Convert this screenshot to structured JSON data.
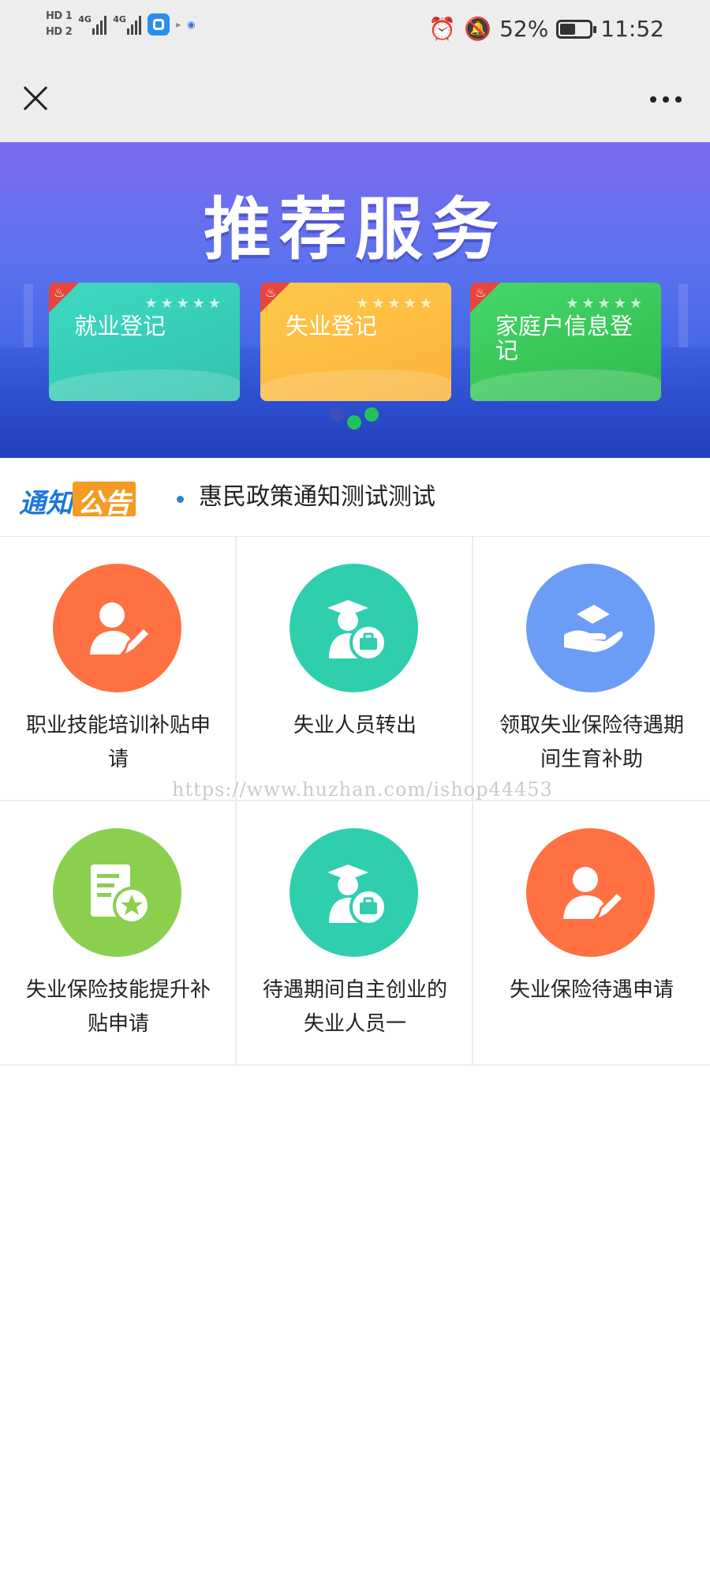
{
  "status_bar": {
    "hd1": "HD 1",
    "hd2": "HD 2",
    "net1": "4G",
    "net2": "4G",
    "battery_percent": "52%",
    "battery_level": 0.52,
    "time": "11:52",
    "icons": [
      "alarm-icon",
      "mute-bell-icon"
    ]
  },
  "banner": {
    "title": "推荐服务",
    "cards": [
      {
        "label": "就业登记",
        "color": "#2fc3ad"
      },
      {
        "label": "失业登记",
        "color": "#fbb23a"
      },
      {
        "label": "家庭户信息登记",
        "color": "#2fbb4c"
      }
    ],
    "active_slide": 2,
    "slide_count": 3
  },
  "notice": {
    "logo_part1": "通知",
    "logo_part2": "公告",
    "text": "惠民政策通知测试测试"
  },
  "services": [
    {
      "label": "职业技能培训补贴申请",
      "icon": "person-pen-icon",
      "color": "#ff7043"
    },
    {
      "label": "失业人员转出",
      "icon": "graduate-briefcase-icon",
      "color": "#2fcfae"
    },
    {
      "label": "领取失业保险待遇期间生育补助",
      "icon": "hand-care-icon",
      "color": "#6b9cf6"
    },
    {
      "label": "失业保险技能提升补贴申请",
      "icon": "document-star-icon",
      "color": "#8bcf4f"
    },
    {
      "label": "待遇期间自主创业的失业人员一",
      "icon": "graduate-briefcase-icon",
      "color": "#2fcfae"
    },
    {
      "label": "失业保险待遇申请",
      "icon": "person-pen-icon",
      "color": "#ff7043"
    }
  ],
  "watermark": "https://www.huzhan.com/ishop44453"
}
